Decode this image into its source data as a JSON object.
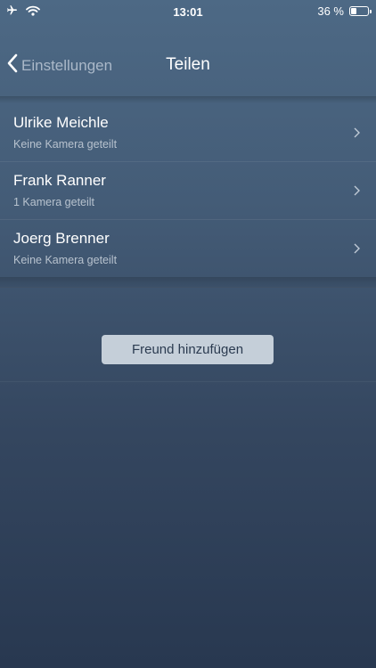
{
  "status_bar": {
    "time": "13:01",
    "battery_text": "36 %",
    "battery_level": 0.36,
    "left_icons": [
      "airplane-icon",
      "wifi-icon"
    ]
  },
  "nav": {
    "back_label": "Einstellungen",
    "title": "Teilen"
  },
  "contacts": [
    {
      "name": "Ulrike Meichle",
      "subtitle": "Keine Kamera geteilt"
    },
    {
      "name": "Frank Ranner",
      "subtitle": "1 Kamera geteilt"
    },
    {
      "name": "Joerg Brenner",
      "subtitle": "Keine Kamera geteilt"
    }
  ],
  "add_friend_label": "Freund hinzufügen",
  "colors": {
    "background_top": "#4d6985",
    "background_bottom": "#283850",
    "button_bg": "#c5cfd9",
    "button_text": "#2b3b50"
  }
}
